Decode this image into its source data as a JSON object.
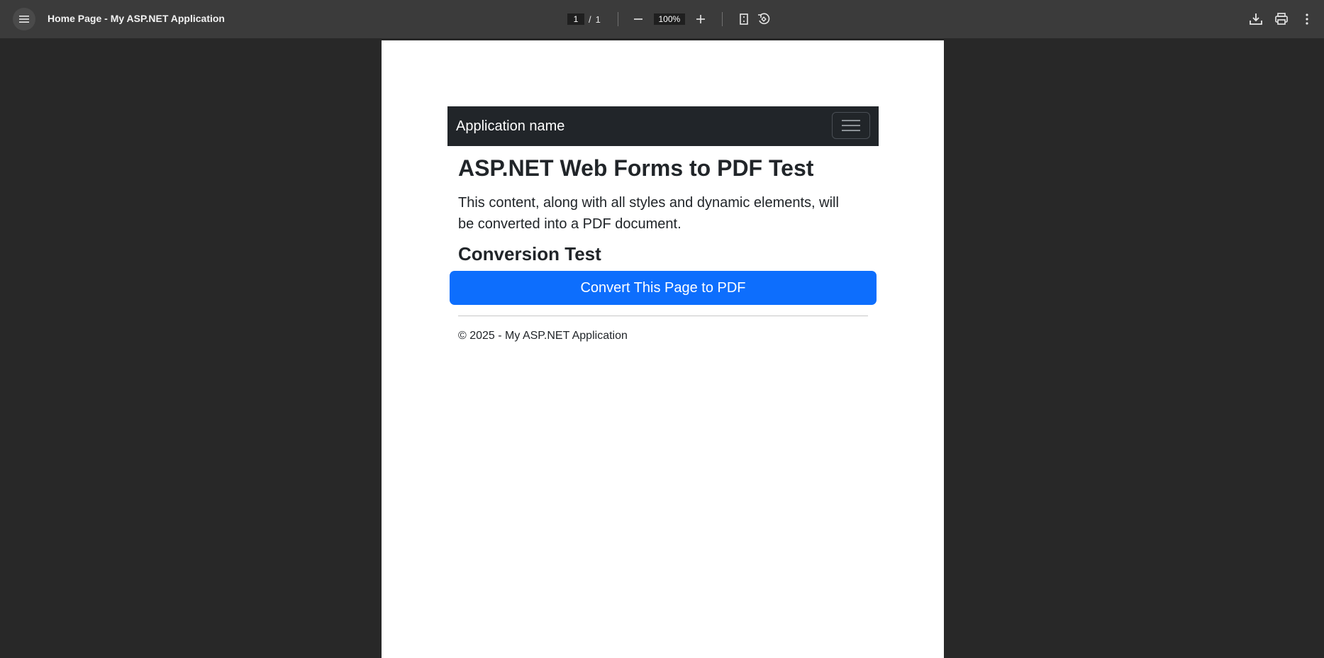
{
  "toolbar": {
    "title": "Home Page - My ASP.NET Application",
    "current_page": "1",
    "page_separator": "/",
    "total_pages": "1",
    "zoom": "100%",
    "icons": {
      "menu": "hamburger-menu-icon",
      "zoom_out": "minus-icon",
      "zoom_in": "plus-icon",
      "fit": "fit-page-icon",
      "rotate": "rotate-icon",
      "download": "download-icon",
      "print": "print-icon",
      "more": "more-vertical-icon"
    }
  },
  "document": {
    "navbar": {
      "brand": "Application name",
      "toggler_icon": "hamburger-icon"
    },
    "heading": "ASP.NET Web Forms to PDF Test",
    "lead": "This content, along with all styles and dynamic elements, will be converted into a PDF document.",
    "subheading": "Conversion Test",
    "convert_button": "Convert This Page to PDF",
    "footer": "© 2025 - My ASP.NET Application"
  },
  "colors": {
    "toolbar_bg": "#3b3b3b",
    "viewer_bg": "#282828",
    "navbar_bg": "#212529",
    "primary_button": "#0d6efd"
  }
}
